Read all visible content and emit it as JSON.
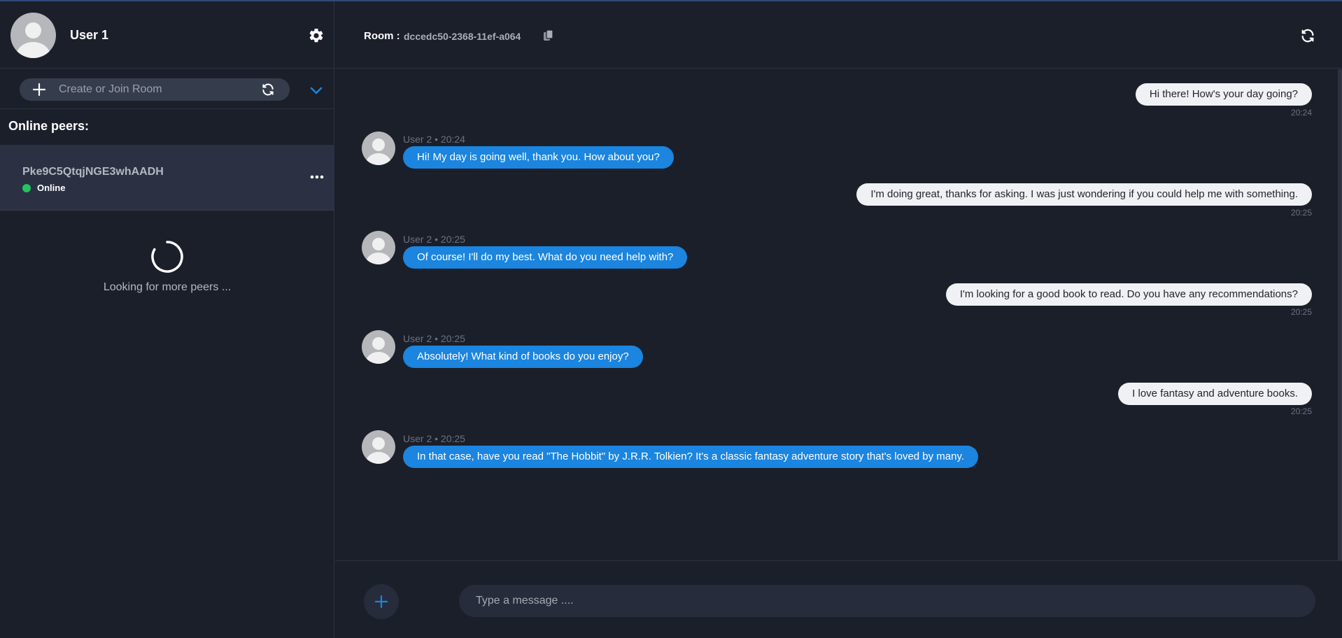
{
  "user": {
    "name": "User 1"
  },
  "room_bar": {
    "placeholder": "Create or Join Room"
  },
  "peers": {
    "title": "Online peers:",
    "items": [
      {
        "id": "Pke9C5QtqjNGE3whAADH",
        "status": "Online"
      }
    ],
    "loading_text": "Looking for more peers ..."
  },
  "header": {
    "room_label": "Room :",
    "room_id": "dccedc50-2368-11ef-a064"
  },
  "messages": [
    {
      "direction": "out",
      "text": "Hi there! How's your day going?",
      "time": "20:24"
    },
    {
      "direction": "in",
      "meta": "User 2 • 20:24",
      "text": "Hi! My day is going well, thank you. How about you?"
    },
    {
      "direction": "out",
      "text": "I'm doing great, thanks for asking. I was just wondering if you could help me with something.",
      "time": "20:25"
    },
    {
      "direction": "in",
      "meta": "User 2 • 20:25",
      "text": "Of course! I'll do my best. What do you need help with?"
    },
    {
      "direction": "out",
      "text": "I'm looking for a good book to read. Do you have any recommendations?",
      "time": "20:25"
    },
    {
      "direction": "in",
      "meta": "User 2 • 20:25",
      "text": "Absolutely! What kind of books do you enjoy?"
    },
    {
      "direction": "out",
      "text": "I love fantasy and adventure books.",
      "time": "20:25"
    },
    {
      "direction": "in",
      "meta": "User 2 • 20:25",
      "text": "In that case, have you read \"The Hobbit\" by J.R.R. Tolkien? It's a classic fantasy adventure story that's loved by many."
    }
  ],
  "composer": {
    "placeholder": "Type a message ...."
  },
  "colors": {
    "background": "#1b1f2a",
    "accent": "#1b85df",
    "online": "#22c55e",
    "outgoing_bubble": "#f0f1f4",
    "peer_highlight": "#2b3142"
  },
  "icons": [
    "gear-icon",
    "plus-icon",
    "refresh-icon",
    "chevron-down-icon",
    "more-icon",
    "copy-icon",
    "avatar-icon",
    "spinner-icon"
  ]
}
